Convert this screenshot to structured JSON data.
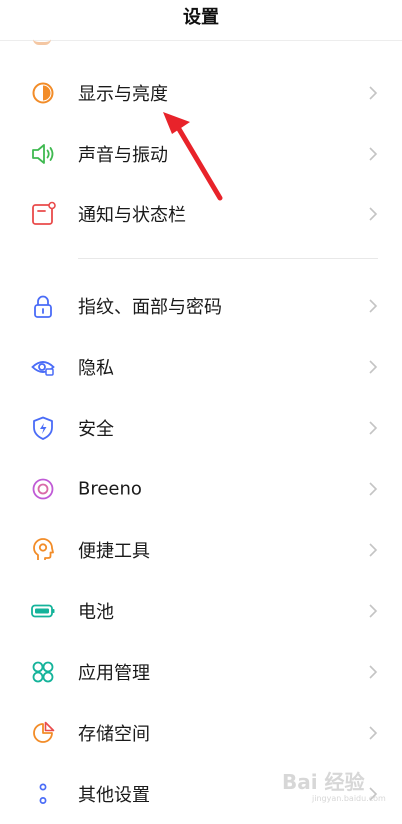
{
  "header": {
    "title": "设置"
  },
  "group1": [
    {
      "label": "显示与亮度",
      "icon": "brightness-icon"
    },
    {
      "label": "声音与振动",
      "icon": "speaker-icon"
    },
    {
      "label": "通知与状态栏",
      "icon": "notification-icon"
    }
  ],
  "group2": [
    {
      "label": "指纹、面部与密码",
      "icon": "lock-icon"
    },
    {
      "label": "隐私",
      "icon": "privacy-eye-icon"
    },
    {
      "label": "安全",
      "icon": "shield-icon"
    },
    {
      "label": "Breeno",
      "icon": "breeno-icon"
    },
    {
      "label": "便捷工具",
      "icon": "tools-icon"
    },
    {
      "label": "电池",
      "icon": "battery-icon"
    },
    {
      "label": "应用管理",
      "icon": "apps-icon"
    },
    {
      "label": "存储空间",
      "icon": "storage-icon"
    },
    {
      "label": "其他设置",
      "icon": "other-settings-icon"
    }
  ],
  "colors": {
    "orange": "#f28c28",
    "green": "#3fb950",
    "red": "#e94b4b",
    "blue": "#4a6cf7",
    "purple": "#c05ad6",
    "teal": "#14b39a",
    "arrow": "#e8232a",
    "chevron": "#c4c4c4"
  },
  "watermark": {
    "main": "Bai 经验",
    "sub": "jingyan.baidu.com"
  }
}
